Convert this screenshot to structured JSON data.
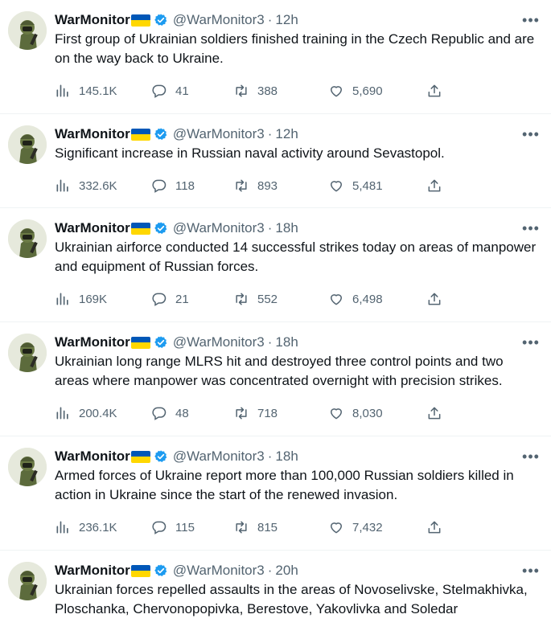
{
  "colors": {
    "accent": "#1d9bf0",
    "muted": "#536471",
    "text": "#0f1419",
    "flag_blue": "#0057b7",
    "flag_yellow": "#ffd700"
  },
  "icons": {
    "views": "bar-chart-icon",
    "reply": "comment-icon",
    "retweet": "retweet-icon",
    "like": "heart-icon",
    "share": "share-icon",
    "more": "more-icon",
    "verified": "verified-badge-icon"
  },
  "tweets": [
    {
      "name": "WarMonitor",
      "handle": "@WarMonitor3",
      "time": "12h",
      "text": "First group of Ukrainian soldiers finished training in the Czech Republic and are on the way back to Ukraine.",
      "views": "145.1K",
      "replies": "41",
      "retweets": "388",
      "likes": "5,690"
    },
    {
      "name": "WarMonitor",
      "handle": "@WarMonitor3",
      "time": "12h",
      "text": "Significant increase in Russian naval activity around Sevastopol.",
      "views": "332.6K",
      "replies": "118",
      "retweets": "893",
      "likes": "5,481"
    },
    {
      "name": "WarMonitor",
      "handle": "@WarMonitor3",
      "time": "18h",
      "text": "Ukrainian airforce conducted 14 successful strikes today on areas of manpower and equipment of Russian forces.",
      "views": "169K",
      "replies": "21",
      "retweets": "552",
      "likes": "6,498"
    },
    {
      "name": "WarMonitor",
      "handle": "@WarMonitor3",
      "time": "18h",
      "text": "Ukrainian long range MLRS hit and destroyed three control points and two areas where manpower was concentrated overnight with precision strikes.",
      "views": "200.4K",
      "replies": "48",
      "retweets": "718",
      "likes": "8,030"
    },
    {
      "name": "WarMonitor",
      "handle": "@WarMonitor3",
      "time": "18h",
      "text": "Armed forces of Ukraine report more than 100,000 Russian soldiers killed in action in Ukraine since the start of the renewed invasion.",
      "views": "236.1K",
      "replies": "115",
      "retweets": "815",
      "likes": "7,432"
    },
    {
      "name": "WarMonitor",
      "handle": "@WarMonitor3",
      "time": "20h",
      "text": "Ukrainian forces repelled assaults in the areas of Novoselivske, Stelmakhivka, Ploschanka, Chervonopopivka, Berestove, Yakovlivka and Soledar",
      "views": "",
      "replies": "",
      "retweets": "",
      "likes": ""
    }
  ]
}
